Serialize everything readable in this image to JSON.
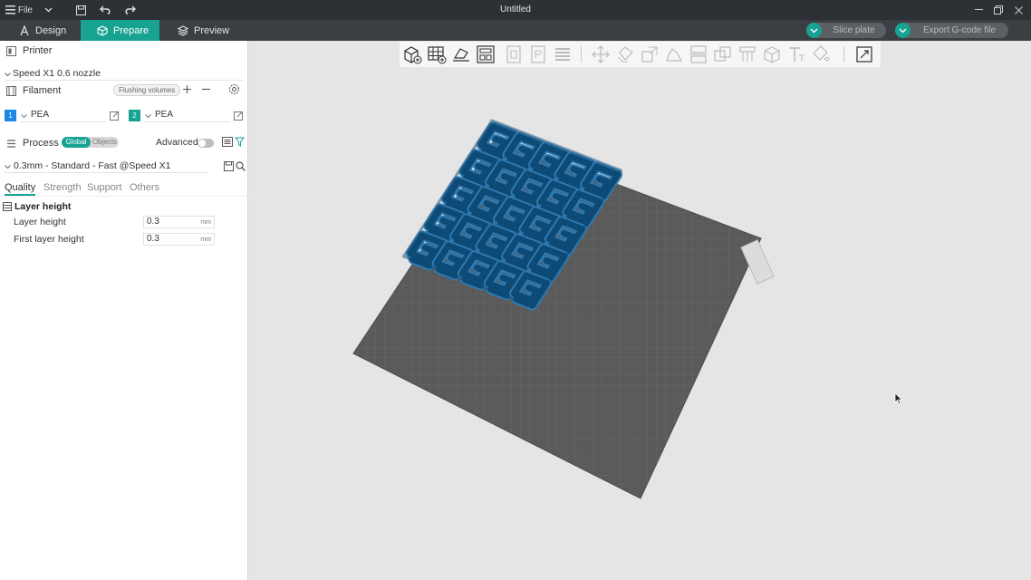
{
  "window": {
    "title": "Untitled",
    "menu_label": "File"
  },
  "tabs": [
    {
      "label": "Design"
    },
    {
      "label": "Prepare"
    },
    {
      "label": "Preview"
    }
  ],
  "actions": {
    "slice_label": "Slice plate",
    "export_label": "Export G-code file"
  },
  "printer": {
    "section_label": "Printer",
    "selected": "Speed X1 0.6 nozzle"
  },
  "filament": {
    "section_label": "Filament",
    "flushing_label": "Flushing volumes",
    "slots": [
      {
        "index": "1",
        "name": "PEA",
        "color": "#1e88e5"
      },
      {
        "index": "2",
        "name": "PEA",
        "color": "#17a292"
      }
    ]
  },
  "process": {
    "section_label": "Process",
    "scope_global": "Global",
    "scope_objects": "Objects",
    "advanced_label": "Advanced",
    "advanced_on": false,
    "profile": "0.3mm - Standard - Fast @Speed X1",
    "subtabs": [
      "Quality",
      "Strength",
      "Support",
      "Others"
    ],
    "active_subtab": "Quality",
    "group_title": "Layer height",
    "params": [
      {
        "label": "Layer height",
        "value": "0.3",
        "unit": "mm"
      },
      {
        "label": "First layer height",
        "value": "0.3",
        "unit": "mm"
      }
    ]
  },
  "viewport": {
    "toolbar_icons": [
      "add-object-icon",
      "add-plate-icon",
      "auto-orient-icon",
      "arrange-icon",
      "split-objects-icon",
      "split-parts-icon",
      "layers-icon",
      "move-icon",
      "rotate-icon",
      "scale-icon",
      "lay-on-face-icon",
      "cut-icon",
      "mesh-boolean-icon",
      "support-paint-icon",
      "seam-paint-icon",
      "text-icon",
      "color-paint-icon",
      "assembly-view-icon"
    ],
    "colors": {
      "model": "#0d4a75",
      "model_edge": "#2e79b0",
      "plate": "#5a5a5a",
      "accent": "#17a292"
    }
  }
}
